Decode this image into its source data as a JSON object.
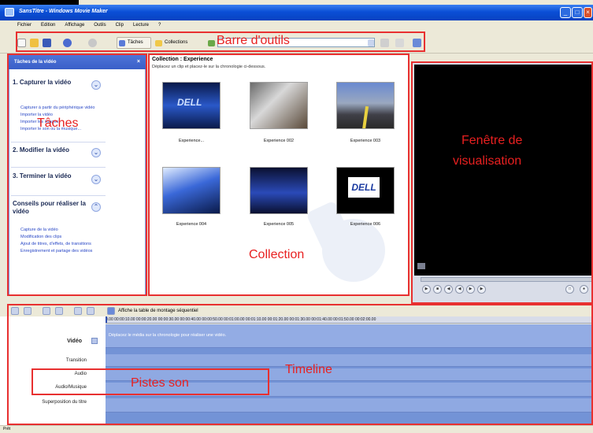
{
  "window": {
    "title": "SansTitre - Windows Movie Maker",
    "controls": {
      "minimize": "_",
      "maximize": "□",
      "close": "×"
    }
  },
  "menu": [
    "Fichier",
    "Edition",
    "Affichage",
    "Outils",
    "Clip",
    "Lecture",
    "?"
  ],
  "toolbar": {
    "tasks_label": "Tâches",
    "collections_label": "Collections"
  },
  "tasks_pane": {
    "header": "Tâches de la vidéo",
    "close": "×",
    "sections": [
      {
        "title": "1. Capturer la vidéo",
        "chevron": "⌄",
        "links": [
          "Capturer à partir du périphérique vidéo",
          "Importer la vidéo",
          "Importer les images",
          "Importer le son ou la musique..."
        ]
      },
      {
        "title": "2. Modifier la vidéo",
        "chevron": "⌄",
        "links": []
      },
      {
        "title": "3. Terminer la vidéo",
        "chevron": "⌄",
        "links": []
      },
      {
        "title": "Conseils pour réaliser la vidéo",
        "chevron": "⌃",
        "links": [
          "Capture de la vidéo",
          "Modification des clips",
          "Ajout de titres, d'effets, de transitions",
          "Enregistrement et partage des vidéos"
        ]
      }
    ]
  },
  "collection": {
    "title": "Collection : Experience",
    "subtitle": "Déplacez un clip et placez-le sur la chronologie ci-dessous.",
    "clips": [
      {
        "label": "Experience..."
      },
      {
        "label": "Experience 002"
      },
      {
        "label": "Experience 003"
      },
      {
        "label": "Experience 004"
      },
      {
        "label": "Experience 005"
      },
      {
        "label": "Experience 006"
      }
    ],
    "dell_logo": "DELL"
  },
  "timeline": {
    "toggle_label": "Affiche la table de montage séquentiel",
    "ruler": "0.00  00:00:10.00  00:00:20.00  00:00:30.00  00:00:40.00  00:00:50.00  00:01:00.00  00:01:10.00  00:01:20.00  00:01:30.00  00:01:40.00  00:01:50.00  00:02:00.00",
    "tracks": [
      "Vidéo",
      "Transition",
      "Audio",
      "Audio/Musique",
      "Superposition du titre"
    ],
    "video_hint": "Déplacez le média sur la chronologie pour réaliser une vidéo."
  },
  "status": "Prêt",
  "annotations": {
    "toolbar": "Barre d'outils",
    "tasks": "Tâches",
    "preview_line1": "Fenêtre de",
    "preview_line2": "visualisation",
    "collection": "Collection",
    "timeline": "Timeline",
    "sound_tracks": "Pistes son",
    "color": "#e83030"
  }
}
